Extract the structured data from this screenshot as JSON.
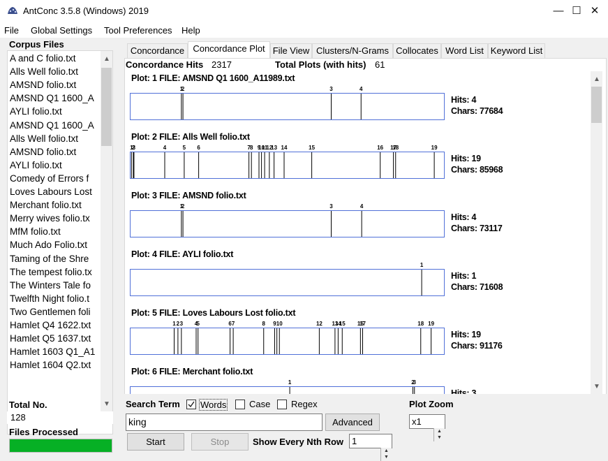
{
  "window": {
    "title": "AntConc 3.5.8 (Windows) 2019",
    "minimize_glyph": "—",
    "maximize_glyph": "☐",
    "close_glyph": "✕"
  },
  "menu": [
    "File",
    "Global Settings",
    "Tool Preferences",
    "Help"
  ],
  "left_panel": {
    "corpus_label": "Corpus Files",
    "files": [
      "A and C folio.txt",
      "Alls Well folio.txt",
      "AMSND folio.txt",
      "AMSND Q1 1600_A",
      "AYLI folio.txt",
      "AMSND Q1 1600_A",
      "Alls Well folio.txt",
      "AMSND folio.txt",
      "AYLI folio.txt",
      "Comedy of Errors f",
      "Loves Labours Lost",
      "Merchant folio.txt",
      "Merry wives folio.tx",
      "MfM folio.txt",
      "Much Ado Folio.txt",
      "Taming of the Shre",
      "The tempest folio.tx",
      "The Winters Tale fo",
      "Twelfth Night folio.t",
      "Two Gentlemen foli",
      "Hamlet Q4 1622.txt",
      "Hamlet Q5 1637.txt",
      "Hamlet 1603 Q1_A1",
      "Hamlet 1604 Q2.txt"
    ],
    "total_no_label": "Total No.",
    "total_no_value": "128",
    "files_processed_label": "Files Processed",
    "progress_fraction": 1.0,
    "progress_color": "#06b025"
  },
  "tabs": [
    {
      "label": "Concordance",
      "active": false
    },
    {
      "label": "Concordance Plot",
      "active": true
    },
    {
      "label": "File View",
      "active": false
    },
    {
      "label": "Clusters/N-Grams",
      "active": false
    },
    {
      "label": "Collocates",
      "active": false
    },
    {
      "label": "Word List",
      "active": false
    },
    {
      "label": "Keyword List",
      "active": false
    }
  ],
  "summary": {
    "hits_label": "Concordance Hits",
    "hits_value": "2317",
    "plots_label": "Total Plots (with hits)",
    "plots_value": "61"
  },
  "plots": [
    {
      "title": "Plot: 1   FILE: AMSND Q1 1600_A11989.txt",
      "hits": "Hits: 4",
      "chars": "Chars: 77684",
      "marks": [
        {
          "pos": 0.163,
          "label": "1"
        },
        {
          "pos": 0.168,
          "label": "2"
        },
        {
          "pos": 0.64,
          "label": "3"
        },
        {
          "pos": 0.735,
          "label": "4"
        }
      ]
    },
    {
      "title": "Plot: 2   FILE: Alls Well folio.txt",
      "hits": "Hits: 19",
      "chars": "Chars: 85968",
      "marks": [
        {
          "pos": 0.004,
          "label": "1"
        },
        {
          "pos": 0.01,
          "label": "2"
        },
        {
          "pos": 0.012,
          "label": "3"
        },
        {
          "pos": 0.11,
          "label": "4"
        },
        {
          "pos": 0.172,
          "label": "5"
        },
        {
          "pos": 0.218,
          "label": "6"
        },
        {
          "pos": 0.378,
          "label": "7"
        },
        {
          "pos": 0.386,
          "label": "8"
        },
        {
          "pos": 0.41,
          "label": "9"
        },
        {
          "pos": 0.418,
          "label": "10"
        },
        {
          "pos": 0.428,
          "label": "11"
        },
        {
          "pos": 0.443,
          "label": "12"
        },
        {
          "pos": 0.458,
          "label": "13"
        },
        {
          "pos": 0.49,
          "label": "14"
        },
        {
          "pos": 0.578,
          "label": "15"
        },
        {
          "pos": 0.796,
          "label": "16"
        },
        {
          "pos": 0.838,
          "label": "17"
        },
        {
          "pos": 0.845,
          "label": "18"
        },
        {
          "pos": 0.968,
          "label": "19"
        }
      ]
    },
    {
      "title": "Plot: 3   FILE: AMSND folio.txt",
      "hits": "Hits: 4",
      "chars": "Chars: 73117",
      "marks": [
        {
          "pos": 0.163,
          "label": "1"
        },
        {
          "pos": 0.168,
          "label": "2"
        },
        {
          "pos": 0.64,
          "label": "3"
        },
        {
          "pos": 0.737,
          "label": "4"
        }
      ]
    },
    {
      "title": "Plot: 4   FILE: AYLI folio.txt",
      "hits": "Hits: 1",
      "chars": "Chars: 71608",
      "marks": [
        {
          "pos": 0.928,
          "label": "1"
        }
      ]
    },
    {
      "title": "Plot: 5   FILE: Loves Labours Lost folio.txt",
      "hits": "Hits: 19",
      "chars": "Chars: 91176",
      "marks": [
        {
          "pos": 0.14,
          "label": "1"
        },
        {
          "pos": 0.152,
          "label": "2"
        },
        {
          "pos": 0.163,
          "label": "3"
        },
        {
          "pos": 0.21,
          "label": "4"
        },
        {
          "pos": 0.216,
          "label": "5"
        },
        {
          "pos": 0.318,
          "label": "6"
        },
        {
          "pos": 0.328,
          "label": "7"
        },
        {
          "pos": 0.425,
          "label": "8"
        },
        {
          "pos": 0.46,
          "label": "9"
        },
        {
          "pos": 0.475,
          "label": "10"
        },
        {
          "pos": 0.602,
          "label": "12"
        },
        {
          "pos": 0.652,
          "label": "13"
        },
        {
          "pos": 0.662,
          "label": "14"
        },
        {
          "pos": 0.675,
          "label": "15"
        },
        {
          "pos": 0.733,
          "label": "16"
        },
        {
          "pos": 0.74,
          "label": "17"
        },
        {
          "pos": 0.925,
          "label": "18"
        },
        {
          "pos": 0.958,
          "label": "19"
        },
        {
          "pos": 0.467,
          "label": ""
        }
      ]
    },
    {
      "title": "Plot: 6   FILE: Merchant folio.txt",
      "hits": "Hits: 3",
      "chars": "",
      "marks": [
        {
          "pos": 0.508,
          "label": "1"
        },
        {
          "pos": 0.9,
          "label": "2"
        },
        {
          "pos": 0.905,
          "label": "3"
        }
      ]
    }
  ],
  "bottom": {
    "search_term_label": "Search Term",
    "words_label": "Words",
    "words_checked": true,
    "case_label": "Case",
    "case_checked": false,
    "regex_label": "Regex",
    "regex_checked": false,
    "search_value": "king",
    "advanced_label": "Advanced",
    "plot_zoom_label": "Plot Zoom",
    "plot_zoom_value": "x1",
    "start_label": "Start",
    "stop_label": "Stop",
    "nth_row_label": "Show Every Nth Row",
    "nth_row_value": "1"
  }
}
